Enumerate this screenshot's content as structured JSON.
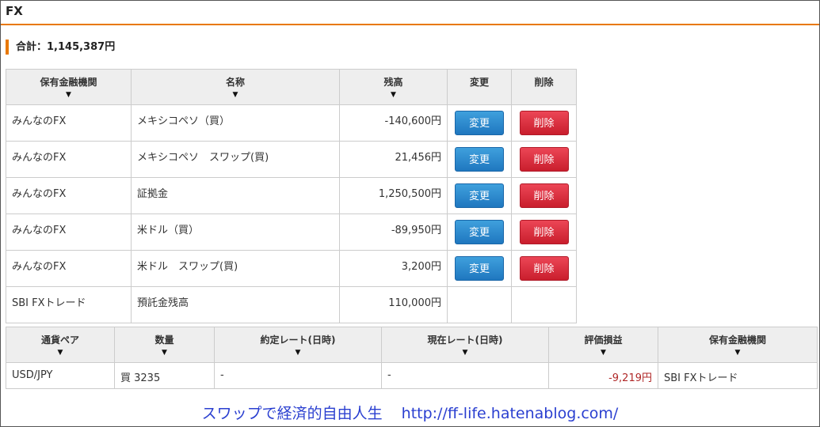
{
  "section": {
    "title": "FX"
  },
  "total": {
    "label": "合計：1,145,387円"
  },
  "accounts_table": {
    "headers": {
      "institution": "保有金融機関",
      "name": "名称",
      "balance": "残高",
      "edit": "変更",
      "delete": "削除"
    },
    "rows": [
      {
        "institution": "みんなのFX",
        "name": "メキシコペソ（買）",
        "balance": "-140,600円",
        "edit_label": "変更",
        "delete_label": "削除"
      },
      {
        "institution": "みんなのFX",
        "name": "メキシコペソ　スワップ(買)",
        "balance": "21,456円",
        "edit_label": "変更",
        "delete_label": "削除"
      },
      {
        "institution": "みんなのFX",
        "name": "証拠金",
        "balance": "1,250,500円",
        "edit_label": "変更",
        "delete_label": "削除"
      },
      {
        "institution": "みんなのFX",
        "name": "米ドル（買）",
        "balance": "-89,950円",
        "edit_label": "変更",
        "delete_label": "削除"
      },
      {
        "institution": "みんなのFX",
        "name": "米ドル　スワップ(買)",
        "balance": "3,200円",
        "edit_label": "変更",
        "delete_label": "削除"
      },
      {
        "institution": "SBI FXトレード",
        "name": "預託金残高",
        "balance": "110,000円"
      }
    ]
  },
  "positions_table": {
    "headers": {
      "pair": "通貨ペア",
      "quantity": "数量",
      "contract_rate": "約定レート(日時)",
      "current_rate": "現在レート(日時)",
      "pl": "評価損益",
      "institution": "保有金融機関"
    },
    "rows": [
      {
        "pair": "USD/JPY",
        "quantity": "買 3235",
        "contract_rate": "-",
        "current_rate": "-",
        "pl": "-9,219円",
        "institution": "SBI FXトレード"
      }
    ]
  },
  "footer": {
    "text": "スワップで経済的自由人生",
    "url": "http://ff-life.hatenablog.com/"
  },
  "colors": {
    "accent": "#e87800",
    "edit_button": "#2a86cc",
    "delete_button": "#dc3040",
    "loss_text": "#b02828",
    "footer_text": "#2a3fd0"
  },
  "icons": {
    "sort": "sort-down-arrow-icon"
  }
}
